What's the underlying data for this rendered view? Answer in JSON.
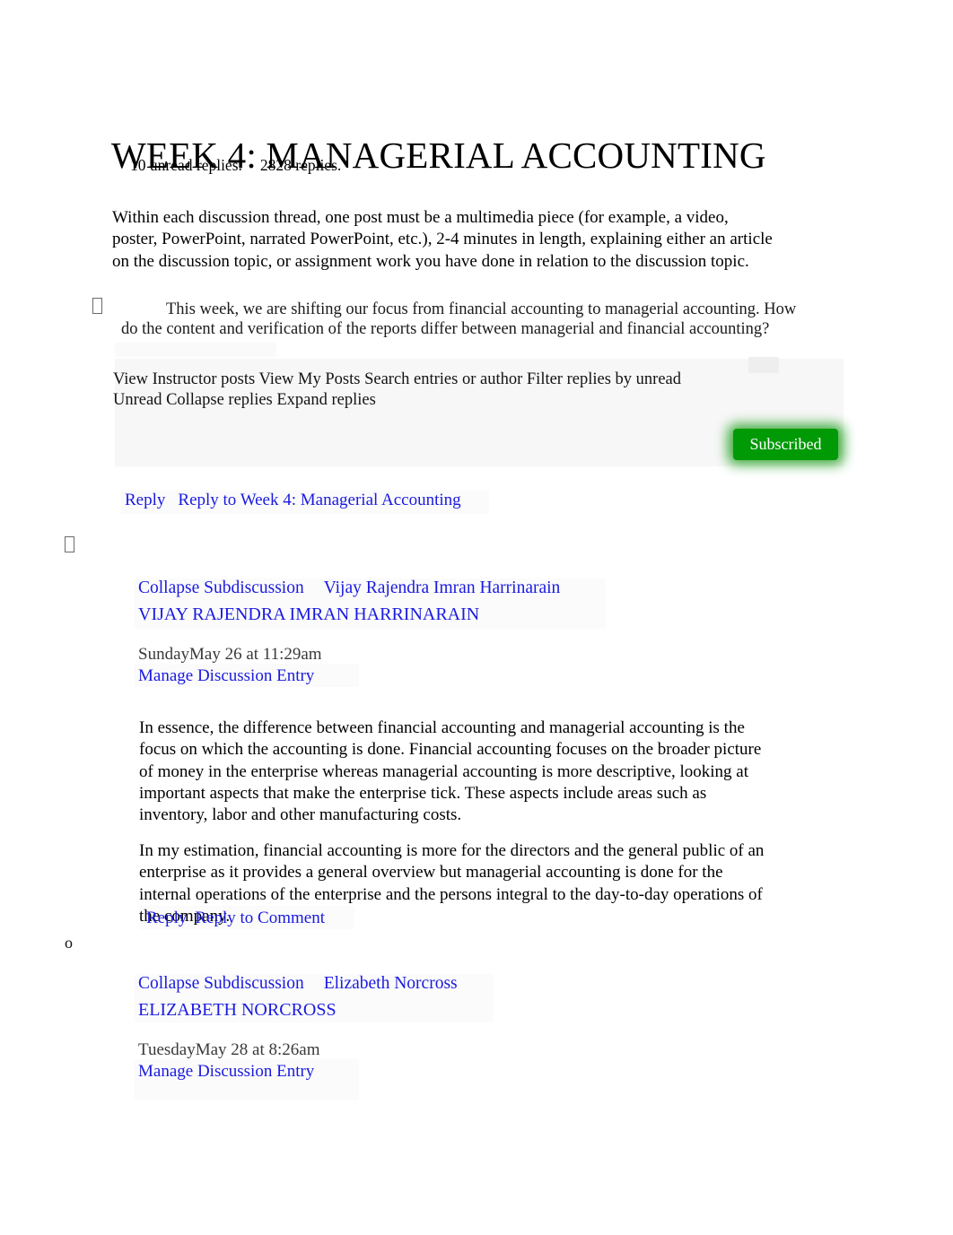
{
  "discussion": {
    "title": "WEEK 4: MANAGERIAL ACCOUNTING",
    "unread_replies": "10 unread replies.",
    "total_replies": "2828 replies.",
    "intro_paragraph": "Within each discussion thread, one post must be a multimedia piece (for example, a video, poster, PowerPoint, narrated PowerPoint, etc.), 2-4 minutes in length, explaining either an article on the discussion topic, or assignment work you have done in relation to the discussion topic.",
    "prompt": "This week, we are shifting our focus from financial accounting to managerial accounting. How do the content and verification of the reports differ between managerial and financial accounting?",
    "bullet_glyph": "tofu-box-glyph",
    "sub_bullet_glyph": "o"
  },
  "toolbar": {
    "line1": "View Instructor posts View My Posts Search entries or author Filter replies by unread",
    "line2": "Unread Collapse replies Expand replies",
    "subscribe_label": "Subscribed",
    "subscribe_color": "#009a06"
  },
  "topic_actions": {
    "reply_label": "Reply",
    "reply_to_label": "Reply to Week 4: Managerial Accounting"
  },
  "entries": [
    {
      "collapse_label": "Collapse Subdiscussion",
      "author_link": "Vijay Rajendra Imran Harrinarain",
      "author_display": "VIJAY RAJENDRA IMRAN HARRINARAIN",
      "timestamp": "SundayMay 26 at 11:29am",
      "manage_label": "Manage Discussion Entry",
      "body_paragraph_1": "In essence, the difference between financial accounting and managerial accounting is the focus on which the accounting is done. Financial accounting focuses on the broader picture of money in the enterprise whereas managerial accounting is more descriptive, looking at important aspects that make the enterprise tick. These aspects include areas such as inventory, labor and other manufacturing costs.",
      "body_paragraph_2": "In my estimation, financial accounting is more for the directors and the general public of an enterprise as it provides a general overview but managerial accounting is done for the internal operations of the enterprise and the persons integral to the day-to-day operations of the company.",
      "reply_label": "Reply",
      "reply_to_label": "Reply to Comment"
    },
    {
      "collapse_label": "Collapse Subdiscussion",
      "author_link": "Elizabeth Norcross",
      "author_display": "ELIZABETH NORCROSS",
      "timestamp": "TuesdayMay 28 at 8:26am",
      "manage_label": "Manage Discussion Entry"
    }
  ],
  "colors": {
    "link": "#1a1ae0",
    "text": "#000000",
    "meta": "#3a3a3a",
    "subscribed_green": "#009a06"
  }
}
